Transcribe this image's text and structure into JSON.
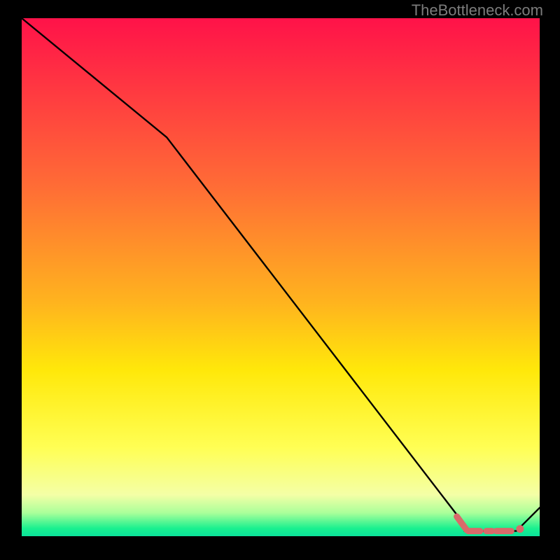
{
  "watermark": "TheBottleneck.com",
  "colors": {
    "background": "#000000",
    "line": "#000000",
    "highlight": "#d86a6a"
  },
  "chart_data": {
    "type": "line",
    "title": "",
    "xlabel": "",
    "ylabel": "",
    "xlim": [
      0,
      1
    ],
    "ylim": [
      0,
      1
    ],
    "gradient_stops": [
      {
        "offset": 0.0,
        "color": "#ff1249"
      },
      {
        "offset": 0.32,
        "color": "#ff6b36"
      },
      {
        "offset": 0.55,
        "color": "#ffb41e"
      },
      {
        "offset": 0.68,
        "color": "#ffe80a"
      },
      {
        "offset": 0.83,
        "color": "#ffff55"
      },
      {
        "offset": 0.92,
        "color": "#f4ffa6"
      },
      {
        "offset": 0.955,
        "color": "#aaff9a"
      },
      {
        "offset": 0.985,
        "color": "#19f08f"
      },
      {
        "offset": 1.0,
        "color": "#0be39a"
      }
    ],
    "series": [
      {
        "name": "curve",
        "x": [
          0.0,
          0.28,
          0.855,
          0.855,
          0.955,
          1.0
        ],
        "y": [
          1.0,
          0.77,
          0.022,
          0.01,
          0.01,
          0.055
        ]
      }
    ],
    "highlight": {
      "segments": [
        {
          "x0": 0.84,
          "y0": 0.038,
          "x1": 0.859,
          "y1": 0.012
        },
        {
          "x0": 0.862,
          "y0": 0.01,
          "x1": 0.885,
          "y1": 0.01
        },
        {
          "x0": 0.897,
          "y0": 0.01,
          "x1": 0.908,
          "y1": 0.01
        },
        {
          "x0": 0.916,
          "y0": 0.01,
          "x1": 0.945,
          "y1": 0.01
        }
      ],
      "point": {
        "x": 0.962,
        "y": 0.014
      }
    }
  }
}
